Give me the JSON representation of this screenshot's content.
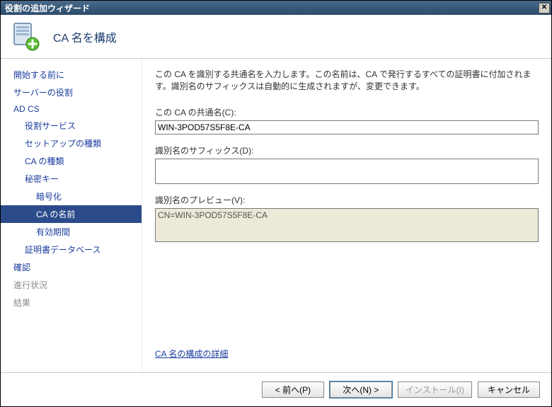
{
  "window": {
    "title": "役割の追加ウィザード"
  },
  "header": {
    "title": "CA 名を構成"
  },
  "sidebar": {
    "items": [
      {
        "label": "開始する前に",
        "level": 0,
        "selected": false
      },
      {
        "label": "サーバーの役割",
        "level": 0,
        "selected": false
      },
      {
        "label": "AD CS",
        "level": 0,
        "selected": false
      },
      {
        "label": "役割サービス",
        "level": 1,
        "selected": false
      },
      {
        "label": "セットアップの種類",
        "level": 1,
        "selected": false
      },
      {
        "label": "CA の種類",
        "level": 1,
        "selected": false
      },
      {
        "label": "秘密キー",
        "level": 1,
        "selected": false
      },
      {
        "label": "暗号化",
        "level": 2,
        "selected": false
      },
      {
        "label": "CA の名前",
        "level": 2,
        "selected": true
      },
      {
        "label": "有効期間",
        "level": 2,
        "selected": false
      },
      {
        "label": "証明書データベース",
        "level": 1,
        "selected": false
      },
      {
        "label": "確認",
        "level": 0,
        "selected": false
      },
      {
        "label": "進行状況",
        "level": 0,
        "selected": false,
        "disabled": true
      },
      {
        "label": "結果",
        "level": 0,
        "selected": false,
        "disabled": true
      }
    ]
  },
  "content": {
    "description": "この CA を識別する共通名を入力します。この名前は、CA で発行するすべての証明書に付加されます。識別名のサフィックスは自動的に生成されますが、変更できます。",
    "common_name_label": "この CA の共通名(C):",
    "common_name_value": "WIN-3POD57S5F8E-CA",
    "dn_suffix_label": "識別名のサフィックス(D):",
    "dn_suffix_value": "",
    "preview_label": "識別名のプレビュー(V):",
    "preview_value": "CN=WIN-3POD57S5F8E-CA",
    "details_link": "CA 名の構成の詳細"
  },
  "footer": {
    "back": "< 前へ(P)",
    "next": "次へ(N) >",
    "install": "インストール(I)",
    "cancel": "キャンセル"
  }
}
